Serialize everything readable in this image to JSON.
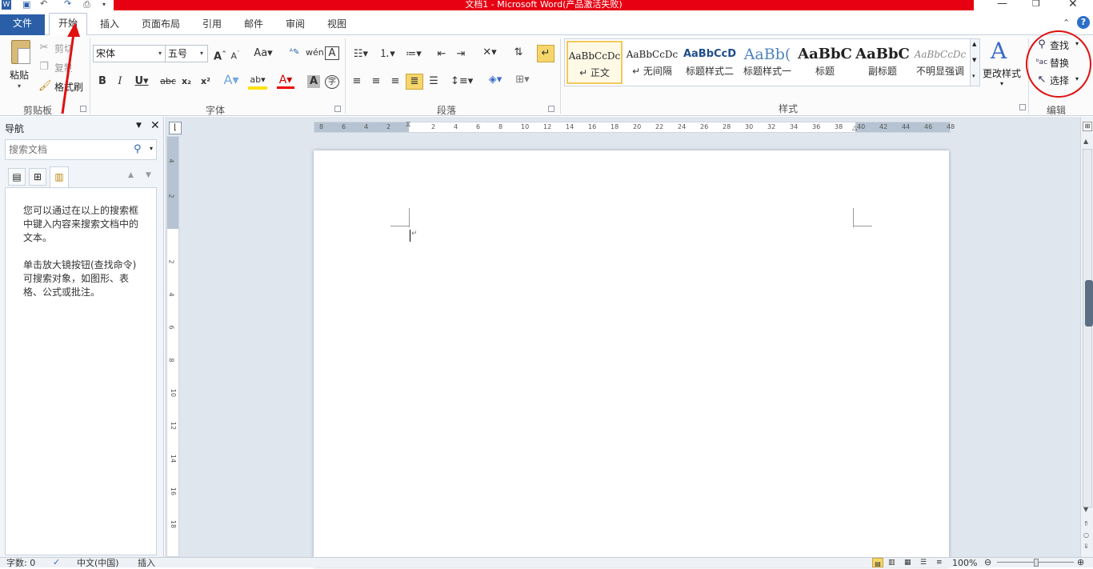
{
  "window": {
    "title": "文档1 - Microsoft Word(产品激活失败)",
    "title_bar_color": "#e60012"
  },
  "tabs": [
    {
      "label": "文件"
    },
    {
      "label": "开始"
    },
    {
      "label": "插入"
    },
    {
      "label": "页面布局"
    },
    {
      "label": "引用"
    },
    {
      "label": "邮件"
    },
    {
      "label": "审阅"
    },
    {
      "label": "视图"
    }
  ],
  "clipboard": {
    "paste": "粘贴",
    "cut": "剪切",
    "copy": "复制",
    "format_painter": "格式刷",
    "group": "剪贴板"
  },
  "font": {
    "name": "宋体",
    "size": "五号",
    "group": "字体"
  },
  "paragraph": {
    "group": "段落"
  },
  "styles": {
    "group": "样式",
    "items": [
      {
        "preview": "AaBbCcDc",
        "name": "↵ 正文"
      },
      {
        "preview": "AaBbCcDc",
        "name": "↵ 无间隔"
      },
      {
        "preview": "AaBbCcD",
        "name": "标题样式二"
      },
      {
        "preview": "AaBb(",
        "name": "标题样式一"
      },
      {
        "preview": "AaBbC",
        "name": "标题"
      },
      {
        "preview": "AaBbC",
        "name": "副标题"
      },
      {
        "preview": "AaBbCcDc",
        "name": "不明显强调"
      }
    ],
    "change_styles": "更改样式"
  },
  "editing": {
    "find": "查找",
    "replace": "替换",
    "select": "选择",
    "group": "编辑"
  },
  "navigation": {
    "title": "导航",
    "search_placeholder": "搜索文档",
    "help_1": "您可以通过在以上的搜索框中键入内容来搜索文档中的文本。",
    "help_2": "单击放大镜按钮(查找命令)可搜索对象，如图形、表格、公式或批注。"
  },
  "ruler": {
    "h_ticks": [
      "8",
      "6",
      "4",
      "2",
      "2",
      "4",
      "6",
      "8",
      "10",
      "12",
      "14",
      "16",
      "18",
      "20",
      "22",
      "24",
      "26",
      "28",
      "30",
      "32",
      "34",
      "36",
      "38",
      "40",
      "42",
      "44",
      "46",
      "48"
    ],
    "v_ticks": [
      "4",
      "2",
      "2",
      "4",
      "6",
      "8",
      "10",
      "12",
      "14",
      "16",
      "18"
    ]
  },
  "status": {
    "word_count": "字数: 0",
    "language": "中文(中国)",
    "insert_mode": "插入",
    "zoom": "100%"
  },
  "colors": {
    "annotation_red": "#e01010",
    "file_tab_blue": "#2a5fa8",
    "highlight_yellow": "#f6d66a"
  }
}
